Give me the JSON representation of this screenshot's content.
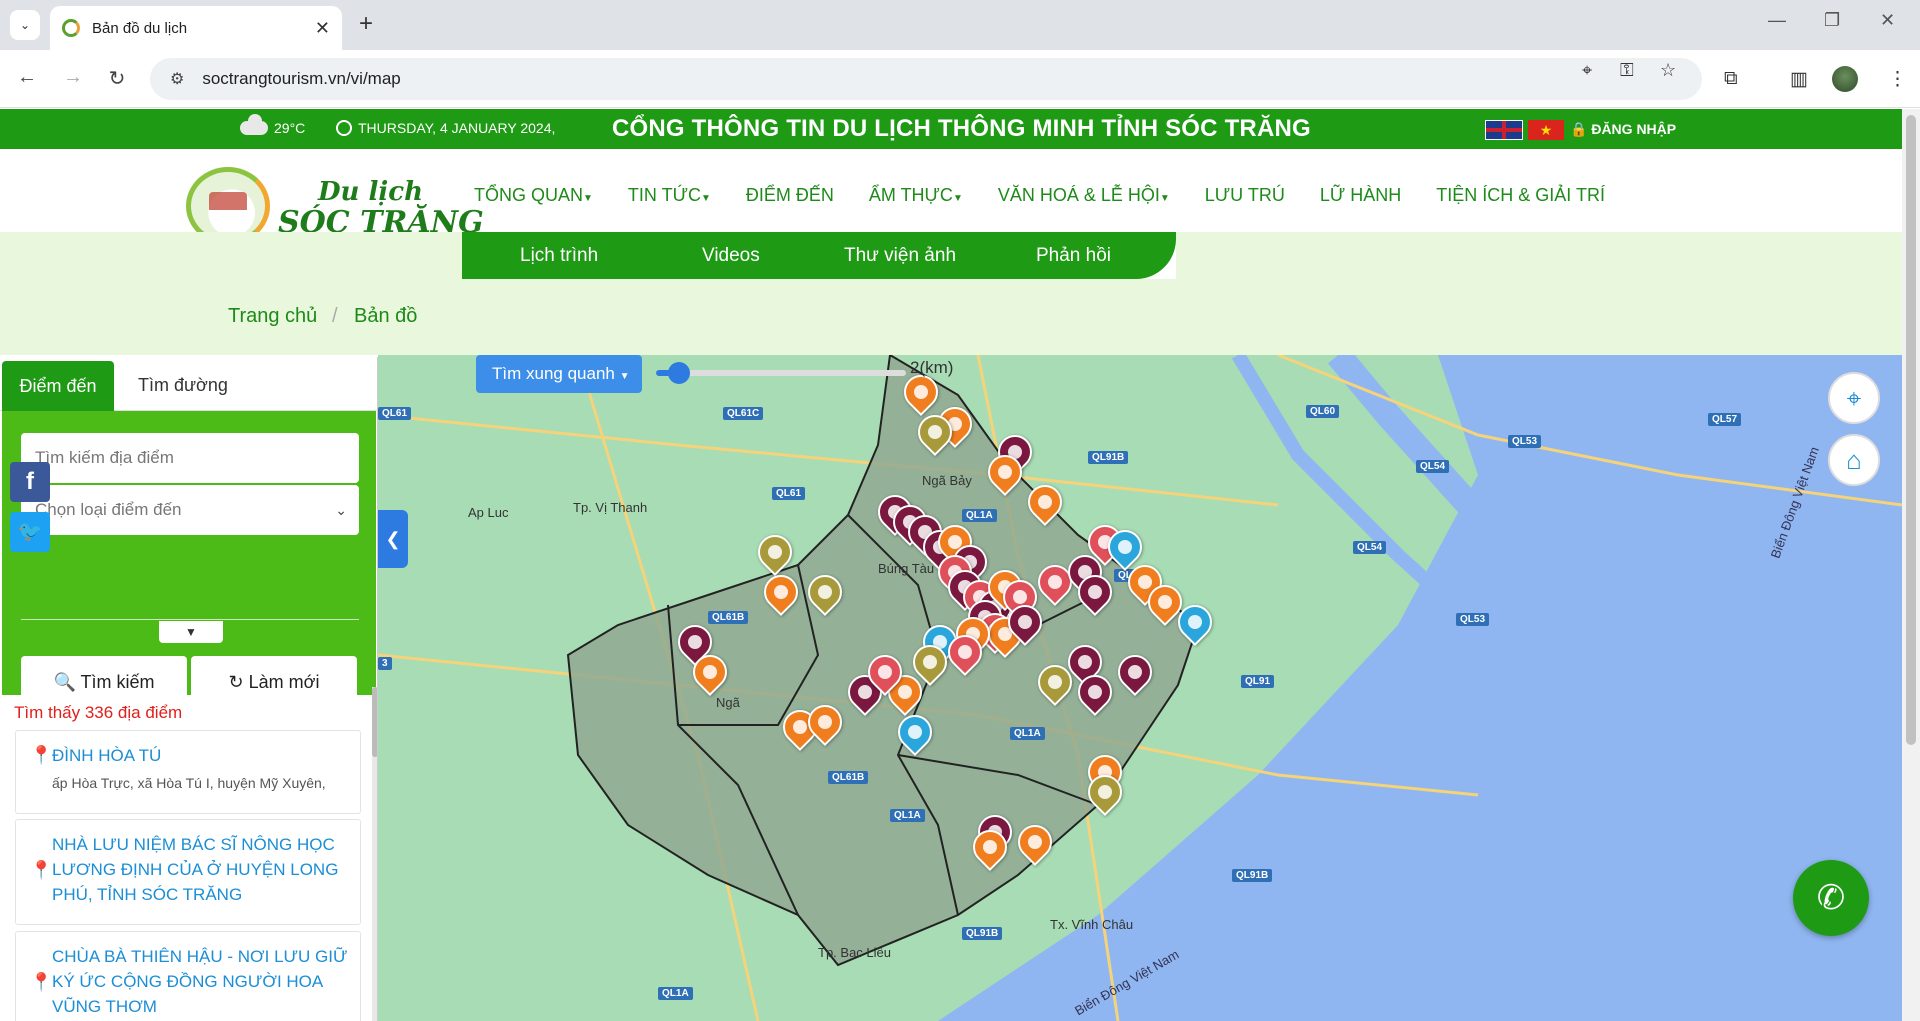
{
  "browser": {
    "tab_title": "Bản đồ du lịch",
    "url": "soctrangtourism.vn/vi/map"
  },
  "topbar": {
    "temperature": "29°C",
    "date": "THURSDAY, 4 JANUARY 2024,",
    "portal_title": "CỔNG THÔNG TIN DU LỊCH THÔNG MINH TỈNH SÓC TRĂNG",
    "login": "ĐĂNG NHẬP"
  },
  "logo": {
    "line1": "Du lịch",
    "line2": "SÓC TRĂNG"
  },
  "main_nav": [
    {
      "label": "TỔNG QUAN",
      "dropdown": true
    },
    {
      "label": "TIN TỨC",
      "dropdown": true
    },
    {
      "label": "ĐIỂM ĐẾN",
      "dropdown": false
    },
    {
      "label": "ẨM THỰC",
      "dropdown": true
    },
    {
      "label": "VĂN HOÁ & LỄ HỘI",
      "dropdown": true
    },
    {
      "label": "LƯU TRÚ",
      "dropdown": false
    },
    {
      "label": "LỮ HÀNH",
      "dropdown": false
    },
    {
      "label": "TIỆN ÍCH & GIẢI TRÍ",
      "dropdown": false
    }
  ],
  "sub_nav": [
    "Lịch trình",
    "Videos",
    "Thư viện ảnh",
    "Phản hồi"
  ],
  "breadcrumb": {
    "home": "Trang chủ",
    "current": "Bản đồ"
  },
  "panel": {
    "tab_active": "Điểm đến",
    "tab_other": "Tìm đường",
    "search_placeholder": "Tìm kiếm địa điểm",
    "type_select": "Chọn loại điểm đến",
    "search_button": "Tìm kiếm",
    "refresh_button": "Làm mới",
    "found_text": "Tìm thấy 336 địa điểm",
    "results": [
      {
        "name": "ĐÌNH HÒA TÚ",
        "address": "ấp Hòa Trực, xã Hòa Tú I, huyện Mỹ Xuyên,"
      },
      {
        "name": "NHÀ LƯU NIỆM BÁC SĨ NÔNG HỌC LƯƠNG ĐỊNH CỦA Ở HUYỆN LONG PHÚ, TỈNH SÓC TRĂNG",
        "address": ""
      },
      {
        "name": "CHÙA BÀ THIÊN HẬU - NƠI LƯU GIỮ KÝ ỨC CỘNG ĐỒNG NGƯỜI HOA VŨNG THƠM",
        "address": ""
      }
    ]
  },
  "map": {
    "nearby_button": "Tìm xung quanh",
    "radius_value": "2(km)",
    "place_labels": [
      "Ap Luc",
      "Tp. Vị Thanh",
      "Ngã Bảy",
      "Búng Tàu",
      "Ngã",
      "Tx. Vĩnh Châu",
      "Tp. Bạc Liêu",
      "Biển Đông Việt Nam",
      "Biển Đông Việt Nam"
    ],
    "road_labels": [
      "QL61",
      "QL61C",
      "QL61",
      "QL1A",
      "QL60",
      "QL91B",
      "QL61B",
      "QL1A",
      "QL61B",
      "QL1A",
      "QL91B",
      "QL91B",
      "QL1A",
      "QL60",
      "QL53",
      "QL54",
      "QL54",
      "QL53",
      "QL57",
      "QL91",
      "3"
    ],
    "colors": {
      "land": "#a8dcb4",
      "sea": "#8fb6f0",
      "province": "#8ea691",
      "culture_pin": "#f07d1e",
      "heritage_pin": "#7a1840",
      "food_pin": "#e0505a",
      "nature_pin": "#a89a3a",
      "beach_pin": "#2ba6dc"
    }
  },
  "icons": {
    "facebook": "facebook-icon",
    "twitter": "twitter-icon",
    "locate": "crosshair-icon",
    "home": "home-icon",
    "messenger": "messenger-icon"
  }
}
